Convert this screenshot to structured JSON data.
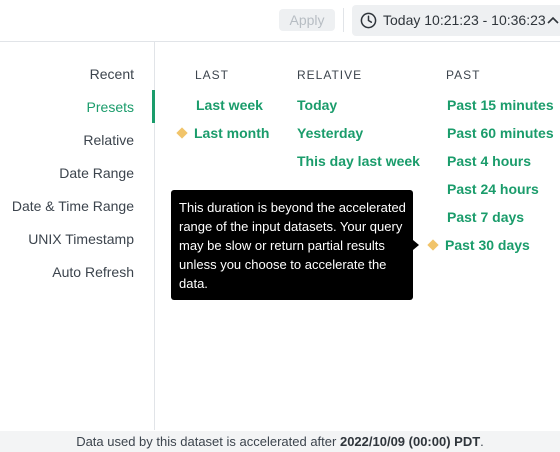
{
  "header": {
    "apply_label": "Apply",
    "time_range": "Today 10:21:23 - 10:36:23"
  },
  "sidebar": {
    "items": [
      {
        "label": "Recent"
      },
      {
        "label": "Presets"
      },
      {
        "label": "Relative"
      },
      {
        "label": "Date Range"
      },
      {
        "label": "Date & Time Range"
      },
      {
        "label": "UNIX Timestamp"
      },
      {
        "label": "Auto Refresh"
      }
    ],
    "active": "Presets"
  },
  "columns": {
    "last": {
      "heading": "LAST",
      "items": [
        "Last week",
        "Last month"
      ]
    },
    "relative": {
      "heading": "RELATIVE",
      "items": [
        "Today",
        "Yesterday",
        "This day last week"
      ]
    },
    "past": {
      "heading": "PAST",
      "items": [
        "Past 15 minutes",
        "Past 60 minutes",
        "Past 4 hours",
        "Past 24 hours",
        "Past 7 days",
        "Past 30 days"
      ]
    }
  },
  "tooltip": {
    "text": "This duration is beyond the accelerated range of the input datasets. Your query may be slow or return partial results unless you choose to accelerate the data."
  },
  "footer": {
    "prefix": "Data used by this dataset is accelerated after",
    "date": "2022/10/09 (00:00) PDT",
    "suffix": "."
  },
  "colors": {
    "accent": "#1a9c6b",
    "warning_diamond": "#f1c46a",
    "tooltip_bg": "#000000"
  },
  "icons": {
    "clock": "clock-icon",
    "chevron": "chevron-up-icon",
    "warning": "warning-diamond-icon"
  }
}
